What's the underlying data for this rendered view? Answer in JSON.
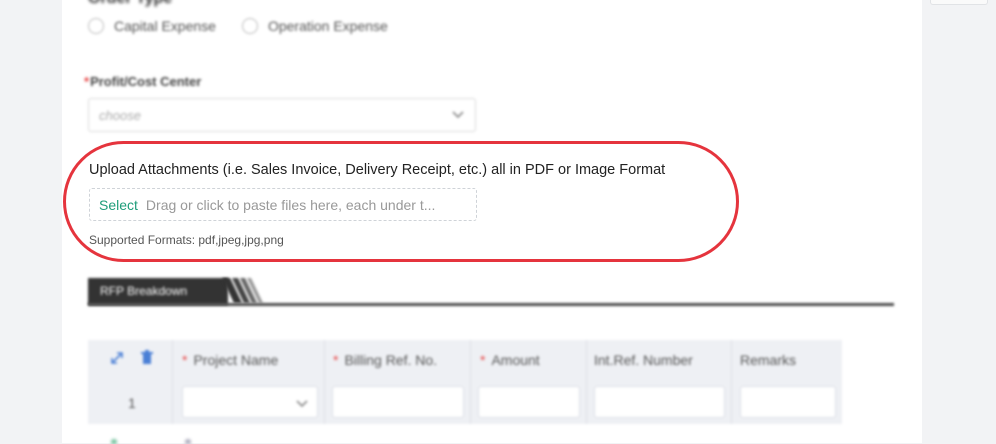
{
  "form": {
    "section_title": "Order Type",
    "expense_options": [
      "Capital Expense",
      "Operation Expense"
    ],
    "profit_center": {
      "label": "Profit/Cost Center",
      "required_mark": "*",
      "placeholder": "choose"
    },
    "upload": {
      "label": "Upload Attachments (i.e. Sales Invoice, Delivery Receipt, etc.) all in PDF or Image Format",
      "select_label": "Select",
      "hint": "Drag or click to paste files here, each under t...",
      "formats": "Supported Formats: pdf,jpeg,jpg,png"
    },
    "breakdown": {
      "tab_label": "RFP Breakdown",
      "columns": [
        {
          "label": "Project Name",
          "required": true
        },
        {
          "label": "Billing Ref. No.",
          "required": true
        },
        {
          "label": "Amount",
          "required": true
        },
        {
          "label": "Int.Ref. Number",
          "required": false
        },
        {
          "label": "Remarks",
          "required": false
        }
      ],
      "required_mark": "*",
      "rows": [
        {
          "number": "1"
        }
      ]
    }
  },
  "colors": {
    "highlight": "#e5343d",
    "select_link": "#1e9d7a",
    "required": "#e64545"
  },
  "icons": {
    "expand": "expand-icon",
    "trash": "trash-icon",
    "chevron": "chevron-down-icon"
  }
}
